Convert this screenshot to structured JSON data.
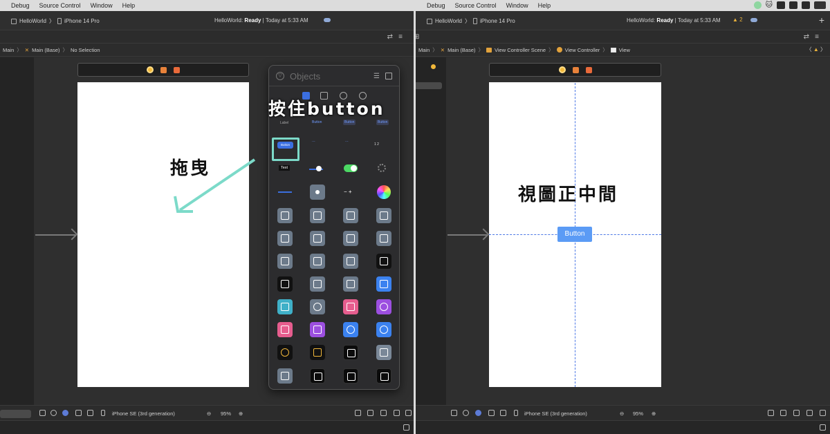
{
  "menu": [
    "Debug",
    "Source Control",
    "Window",
    "Help"
  ],
  "left": {
    "scheme": {
      "project": "HelloWorld",
      "device": "iPhone 14 Pro"
    },
    "status": {
      "prefix": "HelloWorld: ",
      "state": "Ready",
      "time": " | Today at 5:33 AM"
    },
    "jumpbar": [
      "Main",
      "Main (Base)",
      "No Selection"
    ],
    "bottom": {
      "device": "iPhone SE (3rd generation)",
      "zoom": "95%"
    },
    "library": {
      "title": "Objects",
      "label_cell": "Label",
      "button_cell": "Button",
      "button_plain": "Button",
      "button_gray": "Button",
      "button_filled": "Button",
      "segment_text": "1  2",
      "text_field": "Text"
    },
    "annotation_hold": "按住button",
    "annotation_drag": "拖曳"
  },
  "right": {
    "scheme": {
      "project": "HelloWorld",
      "device": "iPhone 14 Pro"
    },
    "status": {
      "prefix": "HelloWorld: ",
      "state": "Ready",
      "time": " | Today at 5:33 AM"
    },
    "warning_count": "2",
    "jumpbar": [
      "Main",
      "Main (Base)",
      "View Controller Scene",
      "View Controller",
      "View"
    ],
    "bottom": {
      "device": "iPhone SE (3rd generation)",
      "zoom": "95%"
    },
    "placed_button": "Button",
    "annotation_center": "視圖正中間"
  },
  "colors": {
    "accent": "#3b6fe0",
    "highlight": "#7cdac9",
    "warning": "#e9b23c",
    "guide": "#4c78e6"
  }
}
